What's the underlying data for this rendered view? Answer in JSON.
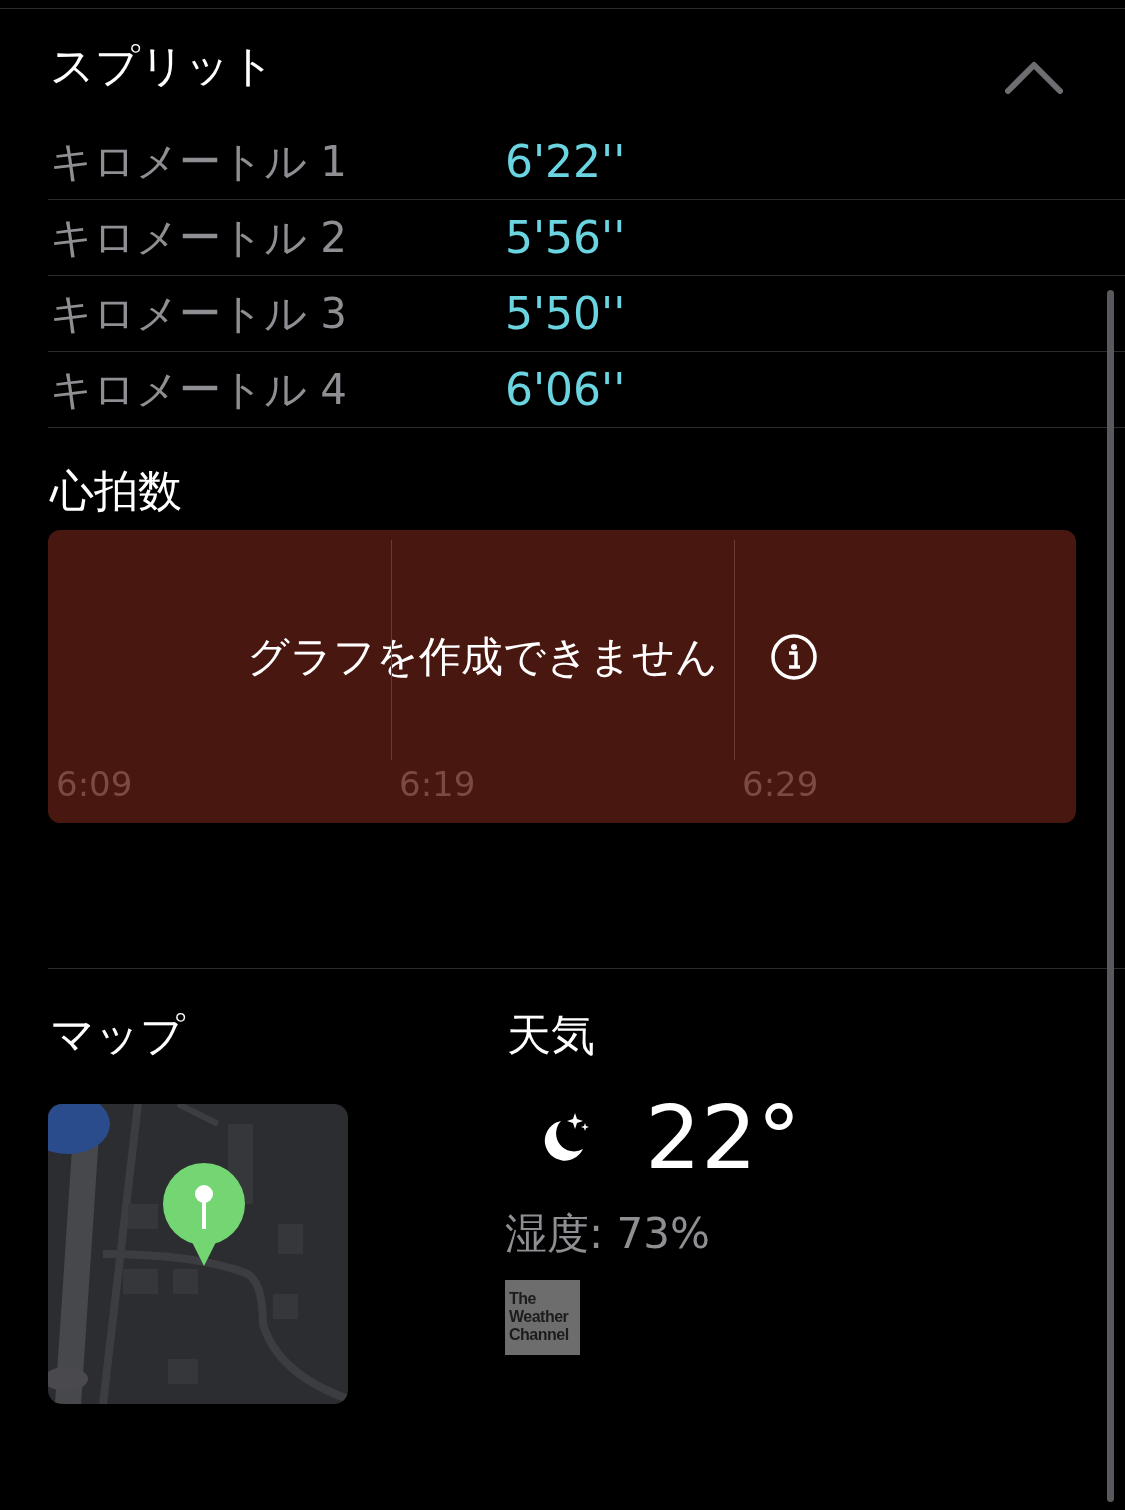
{
  "splits": {
    "title": "スプリット",
    "expanded": true,
    "rows": [
      {
        "label": "キロメートル 1",
        "pace": "6'22''"
      },
      {
        "label": "キロメートル 2",
        "pace": "5'56''"
      },
      {
        "label": "キロメートル 3",
        "pace": "5'50''"
      },
      {
        "label": "キロメートル 4",
        "pace": "6'06''"
      }
    ]
  },
  "heart_rate": {
    "title": "心拍数",
    "message": "グラフを作成できません",
    "time_labels": [
      "6:09",
      "6:19",
      "6:29"
    ]
  },
  "map": {
    "title": "マップ",
    "kind": "picture"
  },
  "weather": {
    "title": "天気",
    "temperature": "22°",
    "humidity": "湿度: 73%",
    "provider_logo": [
      "The",
      "Weather",
      "Channel"
    ]
  }
}
